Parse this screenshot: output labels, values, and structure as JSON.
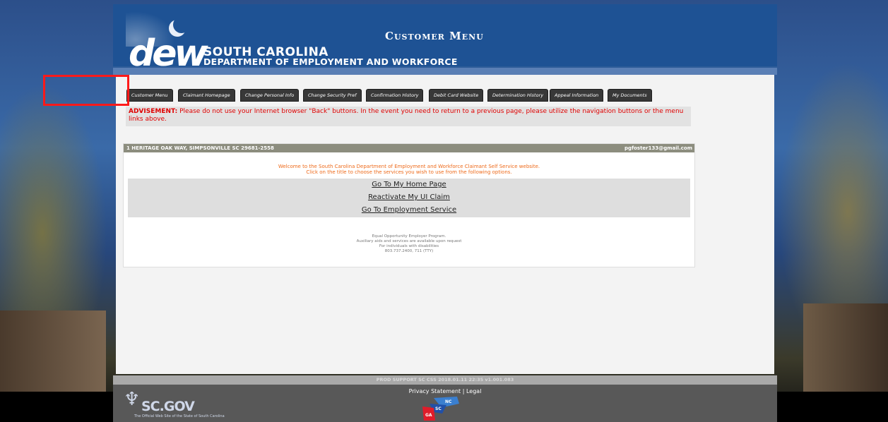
{
  "header": {
    "logo_letters": "dew",
    "logo_state": "SOUTH CAROLINA",
    "logo_dept": "DEPARTMENT OF EMPLOYMENT AND WORKFORCE",
    "title": "Customer Menu"
  },
  "tabs": [
    {
      "label": "Customer Menu"
    },
    {
      "label": "Claimant Homepage"
    },
    {
      "label": "Change Personal Info"
    },
    {
      "label": "Change Security Pref"
    },
    {
      "label": "Confirmation History"
    },
    {
      "label": "Debit Card Website"
    },
    {
      "label": "Determination History"
    },
    {
      "label": "Appeal Information"
    },
    {
      "label": "My Documents"
    }
  ],
  "advisement": {
    "label": "ADVISEMENT:",
    "text": " Please do not use your Internet browser \"Back\" buttons. In the event you need to return to a previous page, please utilize the navigation buttons or the menu links above."
  },
  "user": {
    "address": "1 HERITAGE OAK WAY, SIMPSONVILLE SC 29681-2558",
    "email": "pgfoster133@gmail.com"
  },
  "welcome": {
    "line1": "Welcome to the South Carolina Department of Employment and Workforce Claimant Self Service website.",
    "line2": "Click on the title to choose the services you wish to use from the following options."
  },
  "options": [
    {
      "label": "Go To My Home Page"
    },
    {
      "label": "Reactivate My UI Claim"
    },
    {
      "label": "Go To Employment Service"
    }
  ],
  "eeo": {
    "line1": "Equal Opportunity Employer Program.",
    "line2": "Auxiliary aids and services are available upon request",
    "line3": "For individuals with disabilities",
    "line4": "803.737.2400, 711 (TTY)"
  },
  "footer": {
    "version": "PROD SUPPORT SC CSS 2018.01.11 22:35 v1.001.083",
    "privacy": "Privacy Statement",
    "separator": "|",
    "legal": "Legal",
    "scgov": "SC.GOV",
    "scgov_sub": "The Official Web Site of the State of South Carolina",
    "map_nc": "NC",
    "map_sc": "SC",
    "map_ga": "GA"
  },
  "colors": {
    "header_blue": "#1e5294",
    "advisement_red": "#e00000",
    "welcome_orange": "#ee6a1a",
    "highlight_red": "#ff1a1a"
  }
}
